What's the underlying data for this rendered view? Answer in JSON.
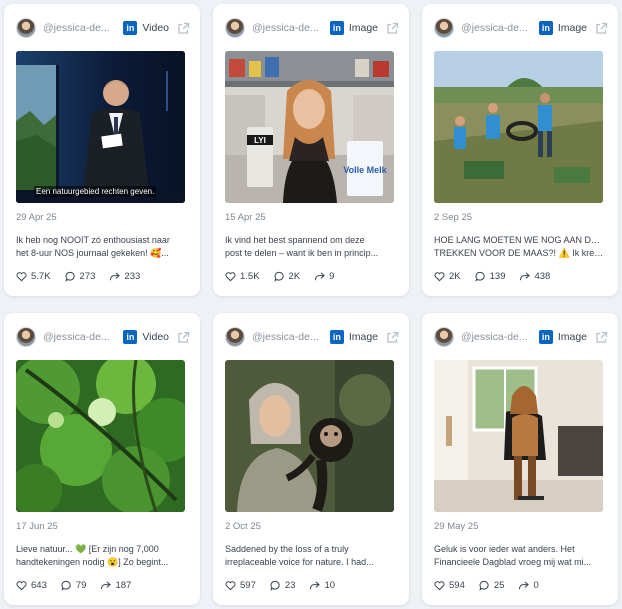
{
  "posts": [
    {
      "handle": "@jessica-de...",
      "type": "Video",
      "date": "29 Apr 25",
      "text1": "Ik heb nog NOOIT zó enthousiast naar",
      "text2": "het 8-uur NOS journaal gekeken! 🥰...",
      "likes": "5.7K",
      "comments": "273",
      "shares": "233",
      "caption": "Een natuurgebied rechten geven."
    },
    {
      "handle": "@jessica-de...",
      "type": "Image",
      "date": "15 Apr 25",
      "text1": "Ik vind het best spannend om deze",
      "text2": "post te delen – want ik ben in princip...",
      "likes": "1.5K",
      "comments": "2K",
      "shares": "9",
      "carton1": "LYI",
      "carton2": "Volle Melk"
    },
    {
      "handle": "@jessica-de...",
      "type": "Image",
      "date": "2 Sep 25",
      "text1": "HOE LANG MOETEN WE NOG AAN DE BEL",
      "text2": "TREKKEN VOOR DE MAAS?! ⚠️ Ik kreeg...",
      "likes": "2K",
      "comments": "139",
      "shares": "438"
    },
    {
      "handle": "@jessica-de...",
      "type": "Video",
      "date": "17 Jun 25",
      "text1": "Lieve natuur... 💚 [Er zijn nog 7,000",
      "text2": "handtekeningen nodig 😮] Zo begint...",
      "likes": "643",
      "comments": "79",
      "shares": "187"
    },
    {
      "handle": "@jessica-de...",
      "type": "Image",
      "date": "2 Oct 25",
      "text1": "Saddened by the loss of a truly",
      "text2": "irreplaceable voice for nature. I had...",
      "likes": "597",
      "comments": "23",
      "shares": "10"
    },
    {
      "handle": "@jessica-de...",
      "type": "Image",
      "date": "29 May 25",
      "text1": "Geluk is voor ieder wat anders. Het",
      "text2": "Financieele Dagblad vroeg mij wat mi...",
      "likes": "594",
      "comments": "25",
      "shares": "0"
    }
  ],
  "linkedin_mark": "in",
  "colors": {
    "linkedin": "#0a66c2",
    "background": "#eef1f5",
    "card": "#ffffff"
  },
  "icons": {
    "network": "linkedin-icon",
    "open": "external-link-icon",
    "likes": "heart-icon",
    "comments": "comment-icon",
    "shares": "share-icon"
  }
}
